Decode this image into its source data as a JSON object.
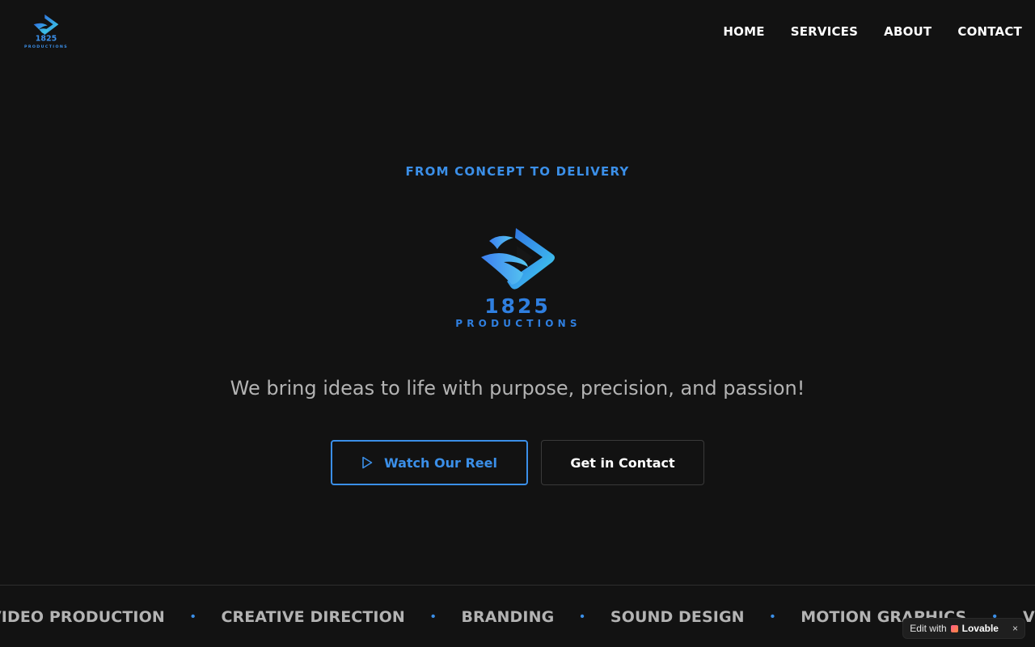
{
  "brand": {
    "number": "1825",
    "name": "PRODUCTIONS",
    "accent": "#3b8fe8"
  },
  "nav": {
    "items": [
      {
        "label": "HOME"
      },
      {
        "label": "SERVICES"
      },
      {
        "label": "ABOUT"
      },
      {
        "label": "CONTACT"
      }
    ]
  },
  "hero": {
    "tagline": "FROM CONCEPT TO DELIVERY",
    "subheading": "We bring ideas to life with purpose, precision, and passion!",
    "buttons": {
      "reel_label": "Watch Our Reel",
      "reel_icon": "play-icon",
      "contact_label": "Get in Contact"
    }
  },
  "ticker": {
    "items": [
      {
        "label": "VIDEO PRODUCTION"
      },
      {
        "label": "CREATIVE DIRECTION"
      },
      {
        "label": "BRANDING"
      },
      {
        "label": "SOUND DESIGN"
      },
      {
        "label": "MOTION GRAPHICS"
      },
      {
        "label": "VIDEO PRODUCTION"
      }
    ],
    "separator": "•"
  },
  "badge": {
    "prefix": "Edit with",
    "brand": "Lovable",
    "close": "×"
  }
}
